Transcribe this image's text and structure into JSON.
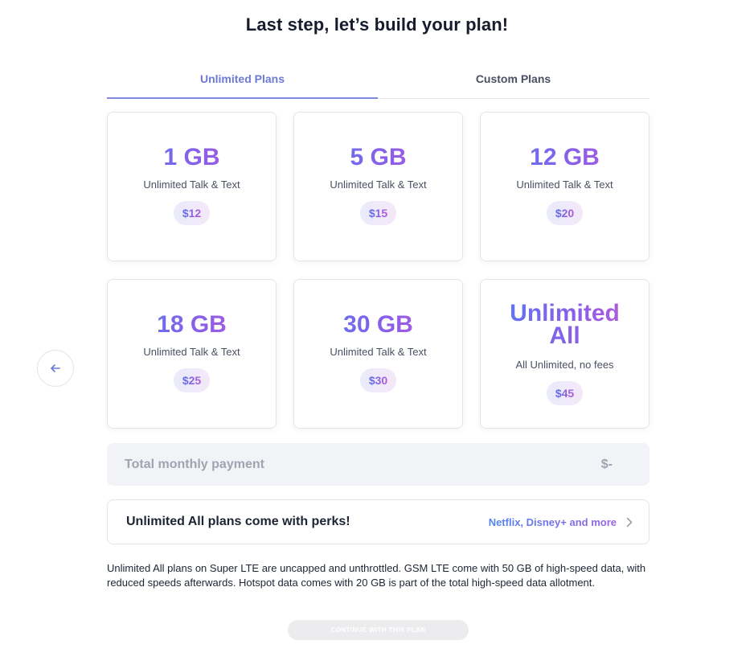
{
  "page": {
    "title": "Last step, let’s build your plan!"
  },
  "tabs": [
    {
      "label": "Unlimited Plans",
      "active": true
    },
    {
      "label": "Custom Plans",
      "active": false
    }
  ],
  "plans": [
    {
      "data": "1 GB",
      "desc": "Unlimited Talk & Text",
      "price": "$12"
    },
    {
      "data": "5 GB",
      "desc": "Unlimited Talk & Text",
      "price": "$15"
    },
    {
      "data": "12 GB",
      "desc": "Unlimited Talk & Text",
      "price": "$20"
    },
    {
      "data": "18 GB",
      "desc": "Unlimited Talk & Text",
      "price": "$25"
    },
    {
      "data": "30 GB",
      "desc": "Unlimited Talk & Text",
      "price": "$30"
    },
    {
      "data_line1": "Unlimited",
      "data_line2": "All",
      "desc": "All Unlimited, no fees",
      "price": "$45"
    }
  ],
  "nav": {
    "prev_icon": "arrow-left-icon"
  },
  "total": {
    "label": "Total monthly payment",
    "value": "$-"
  },
  "perks": {
    "label": "Unlimited All plans come with perks!",
    "link": "Netflix, Disney+ and more",
    "icon": "chevron-right-icon"
  },
  "disclaimer": "Unlimited All plans on Super LTE are uncapped and unthrottled. GSM LTE come with 50 GB of high-speed data, with reduced speeds afterwards. Hotspot data comes with 20 GB is part of the total high-speed data allotment.",
  "continue_label": "CONTINUE WITH THIS PLAN",
  "colors": {
    "accent": "#6b7ad6",
    "gradient_start": "#4f7ff0",
    "gradient_end": "#c15ad6",
    "total_bg": "#f2f3f6"
  }
}
